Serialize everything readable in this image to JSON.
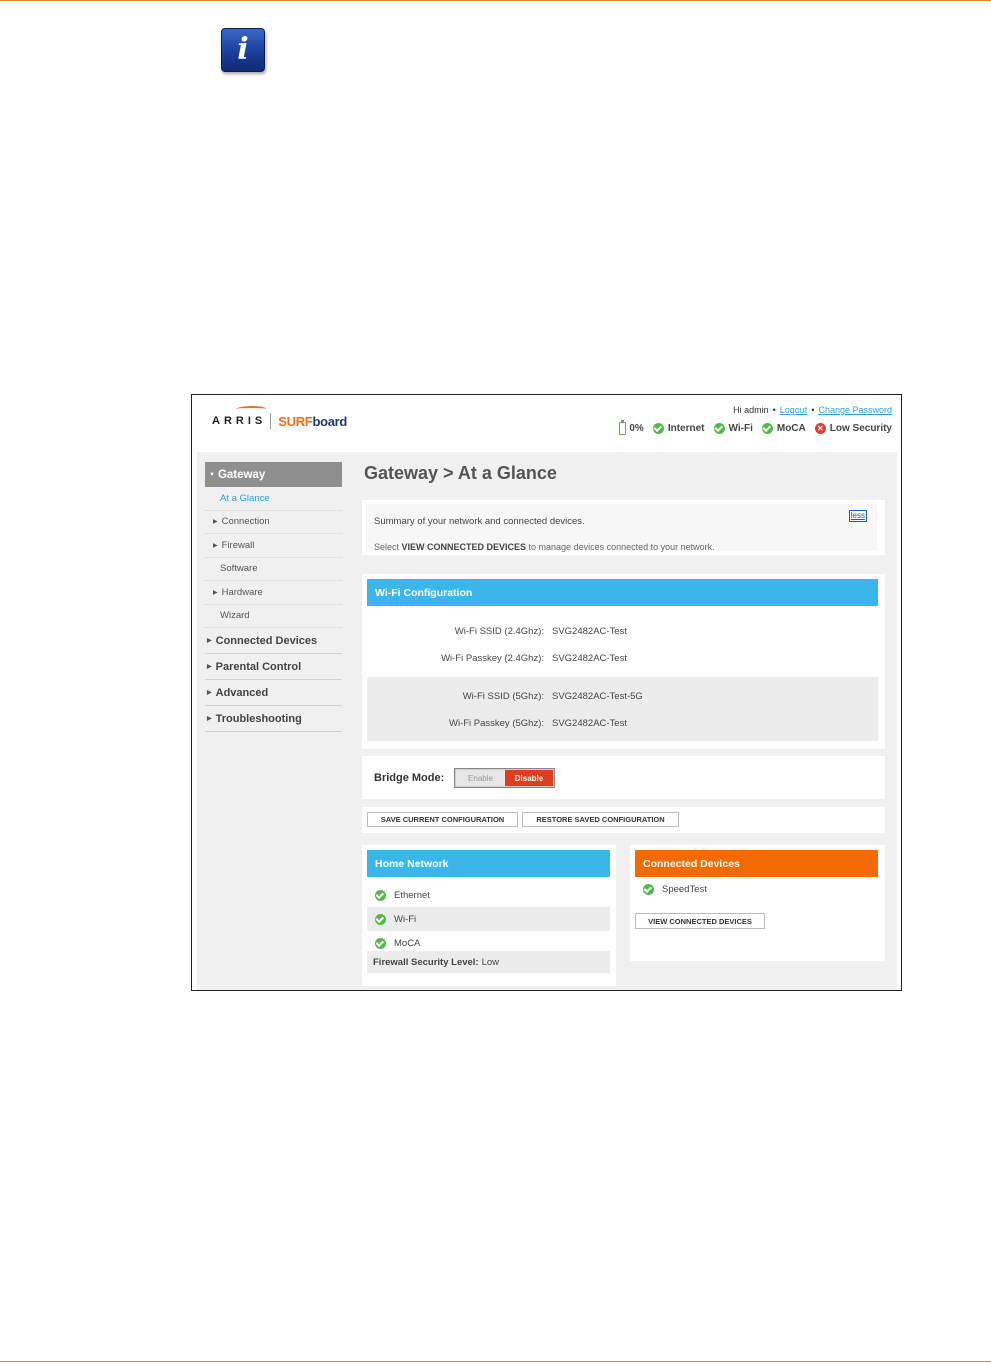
{
  "header": {
    "greeting": "Hi admin",
    "logout": "Logout",
    "change_password": "Change Password",
    "brand_arris": "ARRIS",
    "brand_surf": "SURF",
    "brand_board": "board",
    "status": {
      "battery": "0%",
      "internet": "Internet",
      "wifi": "Wi-Fi",
      "moca": "MoCA",
      "security": "Low Security"
    }
  },
  "nav": {
    "section": "Gateway",
    "sub_items": [
      "At a Glance",
      "Connection",
      "Firewall",
      "Software",
      "Hardware",
      "Wizard"
    ],
    "main_items": [
      "Connected Devices",
      "Parental Control",
      "Advanced",
      "Troubleshooting"
    ]
  },
  "main": {
    "title": "Gateway > At a Glance",
    "summary": {
      "line1": "Summary of your network and connected devices.",
      "line2_pre": "Select ",
      "line2_bold": "VIEW CONNECTED DEVICES",
      "line2_post": " to manage devices connected to your network.",
      "less": "less"
    },
    "wifi": {
      "title": "Wi-Fi Configuration",
      "rows": [
        {
          "label": "Wi-Fi SSID (2.4Ghz):",
          "value": "SVG2482AC-Test"
        },
        {
          "label": "Wi-Fi Passkey (2.4Ghz):",
          "value": "SVG2482AC-Test"
        },
        {
          "label": "Wi-Fi SSID (5Ghz):",
          "value": "SVG2482AC-Test-5G"
        },
        {
          "label": "Wi-Fi Passkey (5Ghz):",
          "value": "SVG2482AC-Test"
        }
      ]
    },
    "bridge": {
      "label": "Bridge Mode:",
      "enable": "Enable",
      "disable": "Disable"
    },
    "config": {
      "save": "SAVE CURRENT CONFIGURATION",
      "restore": "RESTORE SAVED CONFIGURATION"
    },
    "home_network": {
      "title": "Home Network",
      "items": [
        "Ethernet",
        "Wi-Fi",
        "MoCA"
      ],
      "firewall_label": "Firewall Security Level:",
      "firewall_value": "Low"
    },
    "connected_devices": {
      "title": "Connected Devices",
      "items": [
        "SpeedTest"
      ],
      "view_button": "VIEW CONNECTED DEVICES"
    }
  },
  "colors": {
    "accent_blue": "#3bb6ea",
    "accent_orange": "#f26a05",
    "ok_green": "#52b848",
    "alert_red": "#e03c31"
  }
}
